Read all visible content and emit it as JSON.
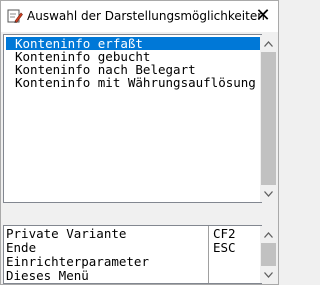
{
  "window": {
    "title": "Auswahl der Darstellungsmöglichkeiten",
    "icon": "pencil-app-icon",
    "close_label": "✕"
  },
  "options_list": {
    "items": [
      {
        "label": "Konteninfo erfaßt",
        "selected": true
      },
      {
        "label": "Konteninfo gebucht",
        "selected": false
      },
      {
        "label": "Konteninfo nach Belegart",
        "selected": false
      },
      {
        "label": "Konteninfo mit Währungsauflösung",
        "selected": false
      }
    ]
  },
  "commands_list": {
    "rows": [
      {
        "label": "Private Variante",
        "key": "CF2"
      },
      {
        "label": "Ende",
        "key": "ESC"
      },
      {
        "label": "Einrichterparameter",
        "key": ""
      },
      {
        "label": "Dieses Menü",
        "key": ""
      }
    ]
  },
  "colors": {
    "selection": "#0078d7",
    "scroll_thumb": "#c1c1c1",
    "border": "#828790"
  }
}
